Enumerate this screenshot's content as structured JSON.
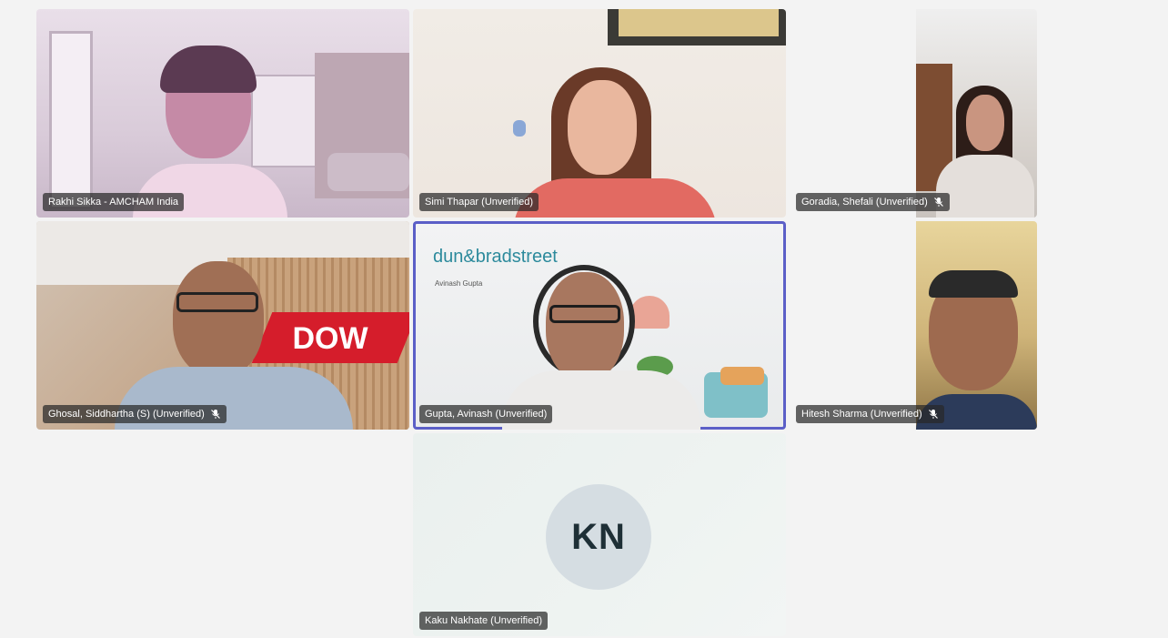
{
  "participants": [
    {
      "name": "Rakhi Sikka - AMCHAM India",
      "muted": false
    },
    {
      "name": "Simi Thapar (Unverified)",
      "muted": false
    },
    {
      "name": "Goradia, Shefali (Unverified)",
      "muted": true
    },
    {
      "name": "Ghosal, Siddhartha (S) (Unverified)",
      "muted": true
    },
    {
      "name": "Gupta, Avinash (Unverified)",
      "muted": false,
      "active_speaker": true
    },
    {
      "name": "Hitesh Sharma (Unverified)",
      "muted": true
    },
    {
      "name": "Kaku Nakhate (Unverified)",
      "muted": false,
      "initials": "KN"
    }
  ],
  "backgrounds": {
    "dnb_logo": "dun&bradstreet",
    "dnb_subtitle": "Avinash Gupta",
    "dow_logo": "DOW"
  },
  "colors": {
    "active_speaker_border": "#5b5fc7",
    "name_tag_bg": "#2b2b2b",
    "avatar_bg": "#d5dde2"
  },
  "icons": {
    "mic_muted": "mic-off-icon"
  }
}
